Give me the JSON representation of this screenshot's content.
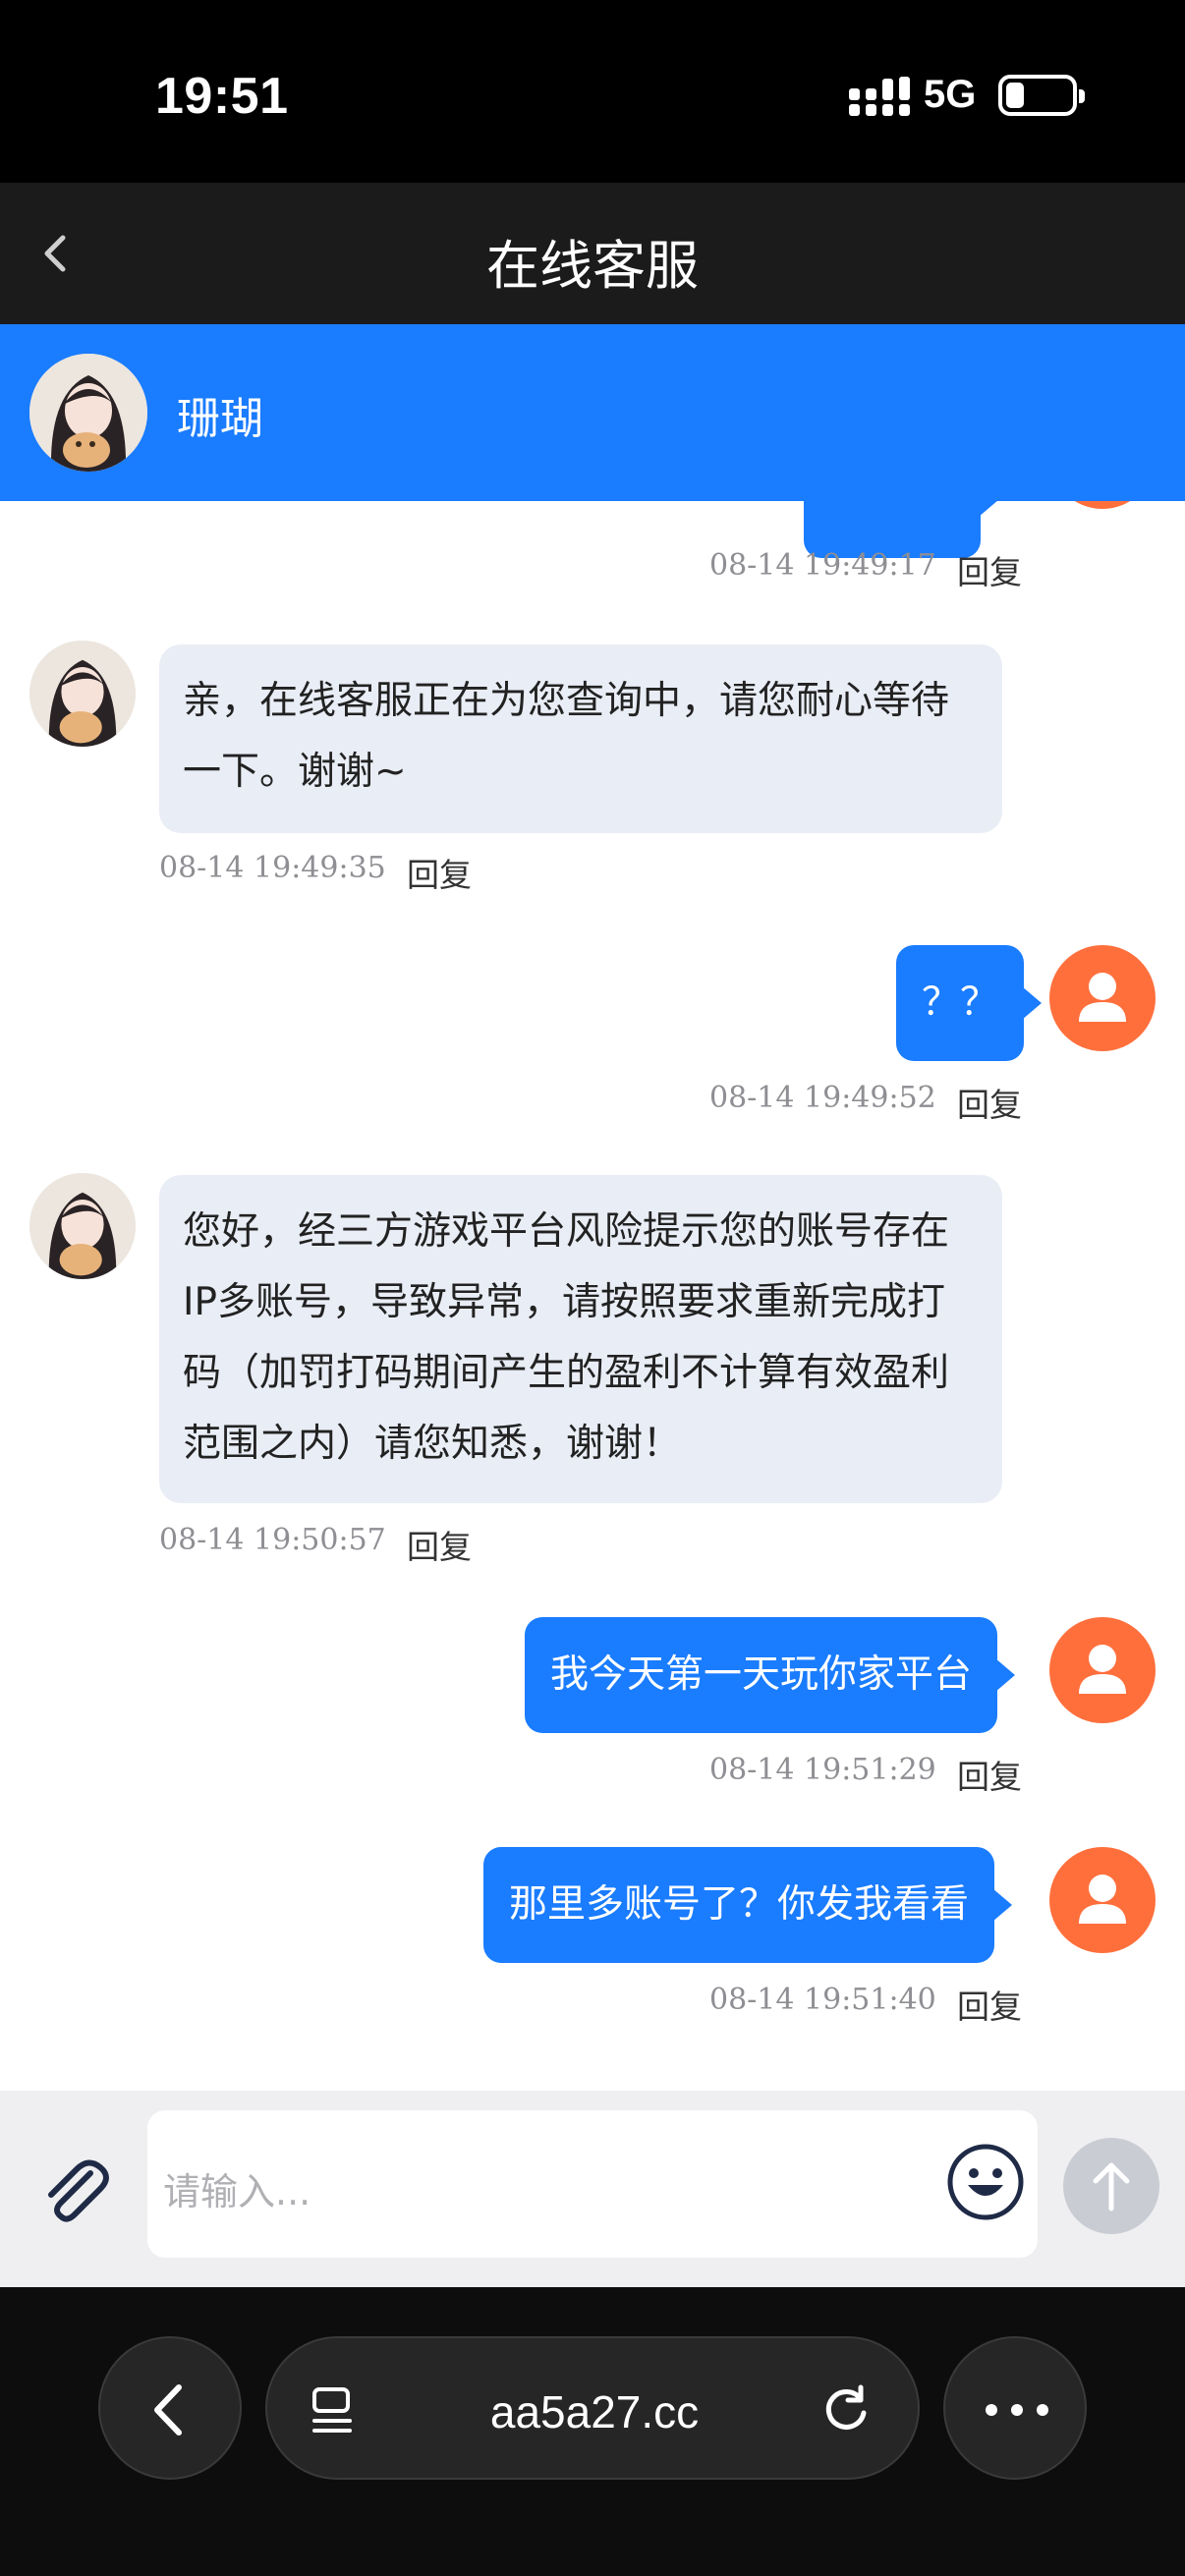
{
  "status_bar": {
    "time": "19:51",
    "network": "5G"
  },
  "nav": {
    "title": "在线客服"
  },
  "agent": {
    "name": "珊瑚"
  },
  "messages": [
    {
      "from": "user",
      "text": "",
      "time": "08-14 19:49:17",
      "reply": "回复"
    },
    {
      "from": "agent",
      "text": "亲，在线客服正在为您查询中，请您耐心等待一下。谢谢~",
      "time": "08-14 19:49:35",
      "reply": "回复"
    },
    {
      "from": "user",
      "text": "？？",
      "time": "08-14 19:49:52",
      "reply": "回复"
    },
    {
      "from": "agent",
      "text": "您好，经三方游戏平台风险提示您的账号存在IP多账号，导致异常，请按照要求重新完成打码（加罚打码期间产生的盈利不计算有效盈利范围之内）请您知悉，谢谢！",
      "time": "08-14 19:50:57",
      "reply": "回复"
    },
    {
      "from": "user",
      "text": "我今天第一天玩你家平台",
      "time": "08-14 19:51:29",
      "reply": "回复"
    },
    {
      "from": "user",
      "text": "那里多账号了？你发我看看",
      "time": "08-14 19:51:40",
      "reply": "回复"
    }
  ],
  "input": {
    "placeholder": "请输入..."
  },
  "browser": {
    "url": "aa5a27.cc"
  },
  "colors": {
    "accent": "#1a7cff",
    "user_avatar": "#ff6f3c",
    "agent_bubble": "#e9edf5"
  }
}
